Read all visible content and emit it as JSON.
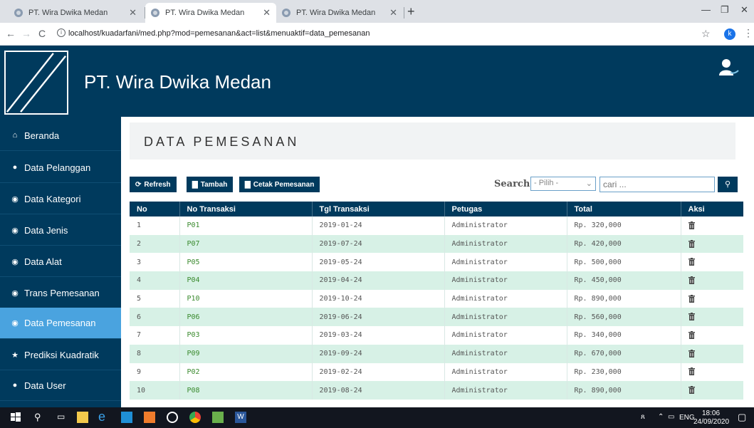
{
  "browser": {
    "tabs": [
      {
        "title": "PT. Wira Dwika Medan"
      },
      {
        "title": "PT. Wira Dwika Medan"
      },
      {
        "title": "PT. Wira Dwika Medan"
      }
    ],
    "url": "localhost/kuadarfani/med.php?mod=pemesanan&act=list&menuaktif=data_pemesanan",
    "profile_initial": "k"
  },
  "app": {
    "name": "PT. Wira Dwika Medan"
  },
  "sidebar": {
    "items": [
      {
        "label": "Beranda",
        "icon": "home-icon"
      },
      {
        "label": "Data Pelanggan",
        "icon": "user-icon"
      },
      {
        "label": "Data Kategori",
        "icon": "dashboard-icon"
      },
      {
        "label": "Data Jenis",
        "icon": "dashboard-icon"
      },
      {
        "label": "Data Alat",
        "icon": "dashboard-icon"
      },
      {
        "label": "Trans Pemesanan",
        "icon": "dashboard-icon"
      },
      {
        "label": "Data Pemesanan",
        "icon": "dashboard-icon",
        "active": true
      },
      {
        "label": "Prediksi Kuadratik",
        "icon": "star-icon"
      },
      {
        "label": "Data User",
        "icon": "user-icon"
      }
    ]
  },
  "page": {
    "title": "DATA PEMESANAN",
    "buttons": {
      "refresh": "Refresh",
      "add": "Tambah",
      "print": "Cetak Pemesanan"
    },
    "search": {
      "label": "Search",
      "select_value": "- Pilih -",
      "placeholder": "cari ..."
    }
  },
  "table": {
    "headers": [
      "No",
      "No Transaksi",
      "Tgl Transaksi",
      "Petugas",
      "Total",
      "Aksi"
    ],
    "rows": [
      [
        "1",
        "P01",
        "2019-01-24",
        "Administrator",
        "Rp. 320,000"
      ],
      [
        "2",
        "P07",
        "2019-07-24",
        "Administrator",
        "Rp. 420,000"
      ],
      [
        "3",
        "P05",
        "2019-05-24",
        "Administrator",
        "Rp. 500,000"
      ],
      [
        "4",
        "P04",
        "2019-04-24",
        "Administrator",
        "Rp. 450,000"
      ],
      [
        "5",
        "P10",
        "2019-10-24",
        "Administrator",
        "Rp. 890,000"
      ],
      [
        "6",
        "P06",
        "2019-06-24",
        "Administrator",
        "Rp. 560,000"
      ],
      [
        "7",
        "P03",
        "2019-03-24",
        "Administrator",
        "Rp. 340,000"
      ],
      [
        "8",
        "P09",
        "2019-09-24",
        "Administrator",
        "Rp. 670,000"
      ],
      [
        "9",
        "P02",
        "2019-02-24",
        "Administrator",
        "Rp. 230,000"
      ],
      [
        "10",
        "P08",
        "2019-08-24",
        "Administrator",
        "Rp. 890,000"
      ]
    ]
  },
  "taskbar": {
    "lang": "ENG",
    "time": "18:06",
    "date": "24/09/2020"
  },
  "colors": {
    "navy": "#003a5d",
    "active": "#4aa3df",
    "stripe": "#d7f1e6",
    "link": "#3a8a2e"
  }
}
